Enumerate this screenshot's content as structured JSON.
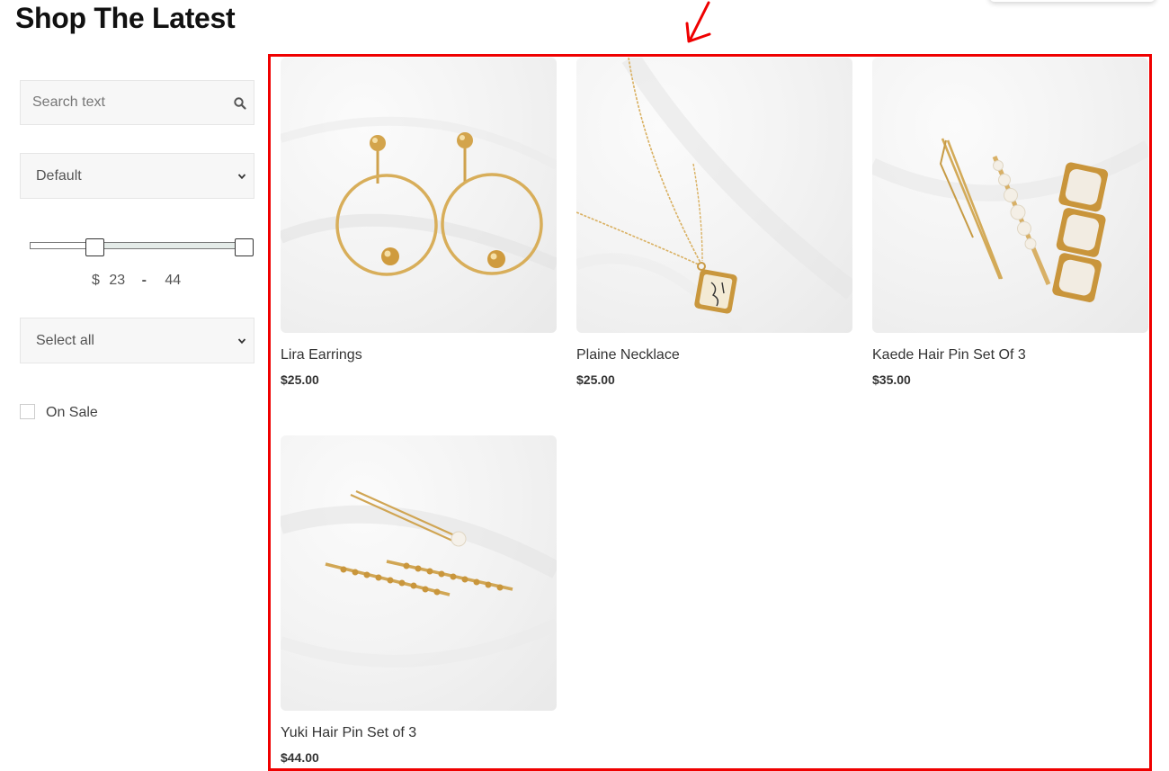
{
  "page": {
    "title": "Shop The Latest"
  },
  "sidebar": {
    "search": {
      "placeholder": "Search text"
    },
    "sort": {
      "selected": "Default"
    },
    "price": {
      "currency": "$",
      "min": "23",
      "separator": "-",
      "max": "44",
      "min_fraction": 0.27,
      "max_fraction": 1.0
    },
    "category": {
      "selected": "Select all"
    },
    "on_sale": {
      "label": "On Sale",
      "checked": false
    }
  },
  "products": [
    {
      "name": "Lira Earrings",
      "price": "$25.00",
      "image": "gold-hoop-earrings"
    },
    {
      "name": "Plaine Necklace",
      "price": "$25.00",
      "image": "gold-square-pendant-necklace"
    },
    {
      "name": "Kaede Hair Pin Set Of 3",
      "price": "$35.00",
      "image": "gold-pearl-hair-pins"
    },
    {
      "name": "Yuki Hair Pin Set of 3",
      "price": "$44.00",
      "image": "gold-beaded-hair-pins"
    }
  ],
  "annotation": {
    "color": "#ef0000"
  },
  "colors": {
    "accent": "#ef0000",
    "gold": "#d4a94e"
  }
}
